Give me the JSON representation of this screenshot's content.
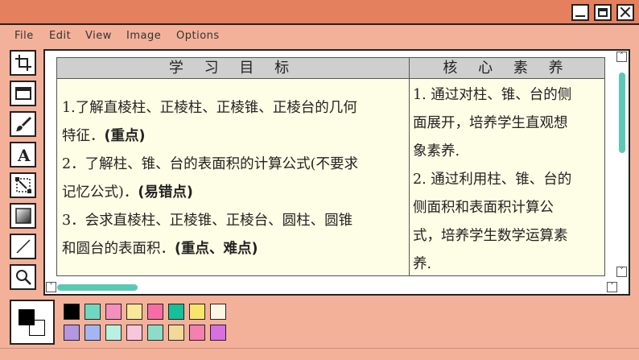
{
  "window": {
    "controls": [
      "minimize-icon",
      "maximize-icon",
      "close-icon"
    ]
  },
  "menu": {
    "file": "File",
    "edit": "Edit",
    "view": "View",
    "image": "Image",
    "options": "Options"
  },
  "tools": [
    "crop-icon",
    "rectangle-select-icon",
    "brush-icon",
    "text-icon",
    "transform-icon",
    "gradient-icon",
    "line-icon",
    "zoom-icon"
  ],
  "document": {
    "left_header": "学 习 目 标",
    "right_header": "核 心 素 养",
    "left": {
      "l1a": "1.了解直棱柱、正棱柱、正棱锥、正棱台的几何",
      "l1b": "特征．",
      "l1c": "(重点)",
      "l2a": "2．了解柱、锥、台的表面积的计算公式(不要求",
      "l2b": "记忆公式)．",
      "l2c": "(易错点)",
      "l3a": "3．会求直棱柱、正棱锥、正棱台、圆柱、圆锥",
      "l3b": "和圆台的表面积．",
      "l3c": "(重点、难点)"
    },
    "right": {
      "r1": "1. 通过对柱、锥、台的侧",
      "r2": "面展开，培养学生直观想",
      "r3": "象素养.",
      "r4": "2. 通过利用柱、锥、台的",
      "r5": "侧面积和表面积计算公",
      "r6": "式，培养学生数学运算素",
      "r7": "养."
    }
  },
  "colors": {
    "titlebar": "#e5805e",
    "background": "#f4b19a",
    "document_bg": "#fefde6",
    "scroll_thumb": "#5ac9b4",
    "foreground": "#000000",
    "background_color": "#ffffff",
    "palette_row1": [
      "#000000",
      "#6fd8c0",
      "#f48fbf",
      "#f9e79a",
      "#f46ea5",
      "#16c09a",
      "#f7e66b",
      "#fcf7e3"
    ],
    "palette_row2": [
      "#b596e0",
      "#a4b6f2",
      "#b8f0e2",
      "#f8c6dc",
      "#8edcc8",
      "#f4d89a",
      "#f47fb0",
      "#d870e0"
    ]
  }
}
